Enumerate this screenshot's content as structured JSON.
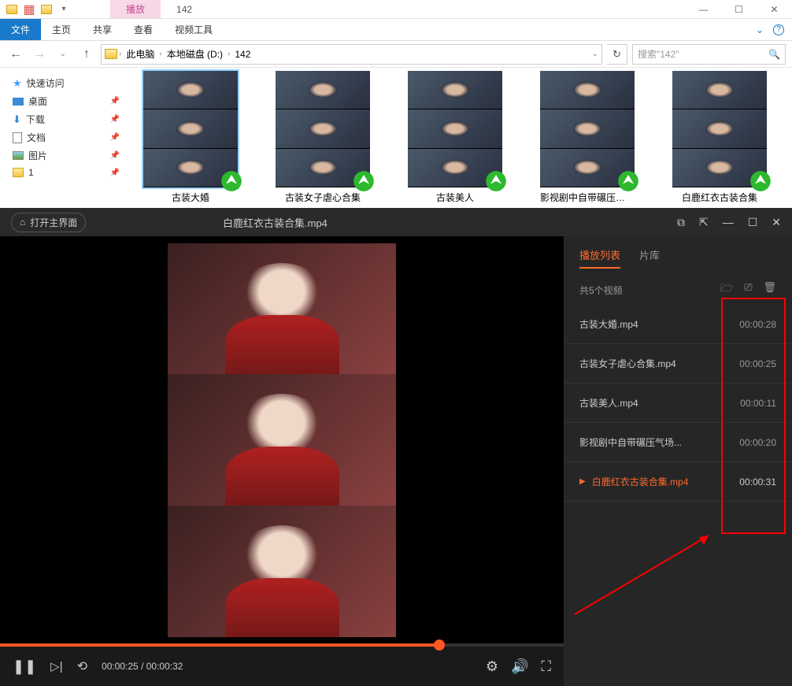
{
  "explorer": {
    "title_tabs": {
      "play": "播放",
      "folder": "142"
    },
    "win": {
      "min": "—",
      "max": "☐",
      "close": "✕"
    },
    "ribbon": {
      "file": "文件",
      "home": "主页",
      "share": "共享",
      "view": "查看",
      "video_tools": "视频工具"
    },
    "nav": {
      "back": "←",
      "fwd": "→",
      "up": "↑"
    },
    "path": {
      "pc": "此电脑",
      "drive": "本地磁盘 (D:)",
      "folder": "142"
    },
    "search_placeholder": "搜索\"142\"",
    "sidebar": {
      "quick": "快速访问",
      "desktop": "桌面",
      "download": "下载",
      "docs": "文档",
      "pics": "图片",
      "one": "1"
    },
    "files": [
      {
        "name": "古装大婚"
      },
      {
        "name": "古装女子虐心合集"
      },
      {
        "name": "古装美人"
      },
      {
        "name": "影视剧中自带碾压气场的"
      },
      {
        "name": "白鹿红衣古装合集"
      }
    ]
  },
  "player": {
    "home": "打开主界面",
    "title": "白鹿红衣古装合集.mp4",
    "time_current": "00:00:25",
    "time_total": "00:00:32",
    "progress_pct": 78,
    "playlist": {
      "tab_list": "播放列表",
      "tab_lib": "片库",
      "count": "共5个视频",
      "items": [
        {
          "name": "古装大婚.mp4",
          "dur": "00:00:28",
          "active": false
        },
        {
          "name": "古装女子虐心合集.mp4",
          "dur": "00:00:25",
          "active": false
        },
        {
          "name": "古装美人.mp4",
          "dur": "00:00:11",
          "active": false
        },
        {
          "name": "影视剧中自带碾压气场...",
          "dur": "00:00:20",
          "active": false
        },
        {
          "name": "白鹿红衣古装合集.mp4",
          "dur": "00:00:31",
          "active": true
        }
      ]
    }
  }
}
